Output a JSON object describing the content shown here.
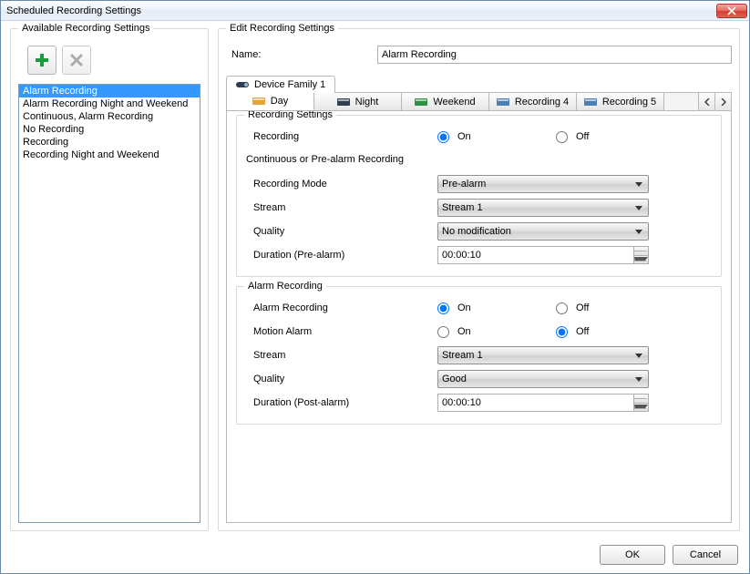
{
  "window": {
    "title": "Scheduled Recording Settings"
  },
  "left": {
    "group_title": "Available Recording Settings",
    "add_icon": "plus",
    "delete_icon": "cross",
    "items": [
      "Alarm Recording",
      "Alarm Recording Night and Weekend",
      "Continuous, Alarm Recording",
      "No Recording",
      "Recording",
      "Recording Night and Weekend"
    ],
    "selected_index": 0
  },
  "right": {
    "group_title": "Edit Recording Settings",
    "name_label": "Name:",
    "name_value": "Alarm Recording",
    "device_tab": "Device Family 1",
    "tabs": [
      "Day",
      "Night",
      "Weekend",
      "Recording 4",
      "Recording 5"
    ],
    "active_tab": 0,
    "icon_colors": [
      "#e6a23c",
      "#2d3e50",
      "#2f8f46",
      "#4a7fb0",
      "#4a7fb0",
      "#2d3e50"
    ],
    "recording_section": {
      "title": "Recording Settings",
      "recording_label": "Recording",
      "on_label": "On",
      "off_label": "Off",
      "recording_value": "On",
      "sub_title": "Continuous or Pre-alarm Recording",
      "mode_label": "Recording Mode",
      "mode_value": "Pre-alarm",
      "stream_label": "Stream",
      "stream_value": "Stream 1",
      "quality_label": "Quality",
      "quality_value": "No modification",
      "duration_label": "Duration (Pre-alarm)",
      "duration_value": "00:00:10"
    },
    "alarm_section": {
      "title": "Alarm Recording",
      "alarm_label": "Alarm Recording",
      "alarm_value": "On",
      "motion_label": "Motion Alarm",
      "motion_value": "Off",
      "on_label": "On",
      "off_label": "Off",
      "stream_label": "Stream",
      "stream_value": "Stream 1",
      "quality_label": "Quality",
      "quality_value": "Good",
      "duration_label": "Duration (Post-alarm)",
      "duration_value": "00:00:10"
    }
  },
  "footer": {
    "ok": "OK",
    "cancel": "Cancel"
  }
}
